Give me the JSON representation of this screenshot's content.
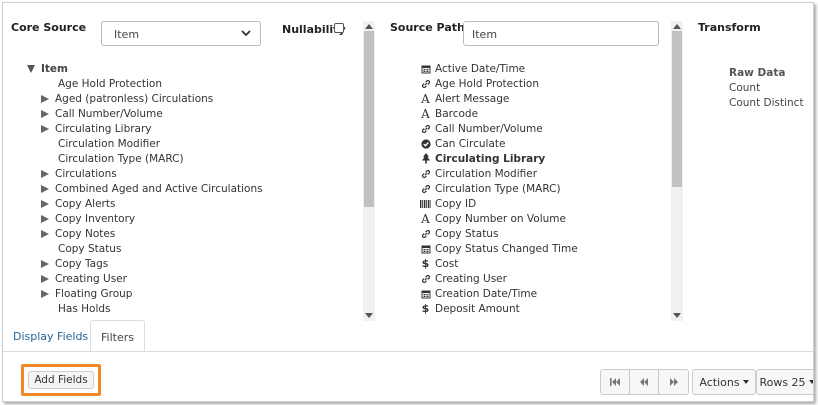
{
  "core_source": {
    "label": "Core Source",
    "selected": "Item",
    "nullability_label": "Nullability"
  },
  "tree": {
    "root": "Item",
    "items": [
      {
        "label": "Age Hold Protection",
        "expandable": false
      },
      {
        "label": "Aged (patronless) Circulations",
        "expandable": true
      },
      {
        "label": "Call Number/Volume",
        "expandable": true
      },
      {
        "label": "Circulating Library",
        "expandable": true
      },
      {
        "label": "Circulation Modifier",
        "expandable": false
      },
      {
        "label": "Circulation Type (MARC)",
        "expandable": false
      },
      {
        "label": "Circulations",
        "expandable": true
      },
      {
        "label": "Combined Aged and Active Circulations",
        "expandable": true
      },
      {
        "label": "Copy Alerts",
        "expandable": true
      },
      {
        "label": "Copy Inventory",
        "expandable": true
      },
      {
        "label": "Copy Notes",
        "expandable": true
      },
      {
        "label": "Copy Status",
        "expandable": false
      },
      {
        "label": "Copy Tags",
        "expandable": true
      },
      {
        "label": "Creating User",
        "expandable": true
      },
      {
        "label": "Floating Group",
        "expandable": true
      },
      {
        "label": "Has Holds",
        "expandable": false
      }
    ]
  },
  "source_path": {
    "label": "Source Path",
    "filter_value": "Item",
    "fields": [
      {
        "label": "Active Date/Time",
        "icon": "calendar-icon",
        "bold": false
      },
      {
        "label": "Age Hold Protection",
        "icon": "link-icon",
        "bold": false
      },
      {
        "label": "Alert Message",
        "icon": "text-icon",
        "bold": false
      },
      {
        "label": "Barcode",
        "icon": "text-icon",
        "bold": false
      },
      {
        "label": "Call Number/Volume",
        "icon": "link-icon",
        "bold": false
      },
      {
        "label": "Can Circulate",
        "icon": "check-circle-icon",
        "bold": false
      },
      {
        "label": "Circulating Library",
        "icon": "org-tree-icon",
        "bold": true
      },
      {
        "label": "Circulation Modifier",
        "icon": "link-icon",
        "bold": false
      },
      {
        "label": "Circulation Type (MARC)",
        "icon": "link-icon",
        "bold": false
      },
      {
        "label": "Copy ID",
        "icon": "barcode-icon",
        "bold": false
      },
      {
        "label": "Copy Number on Volume",
        "icon": "text-icon",
        "bold": false
      },
      {
        "label": "Copy Status",
        "icon": "link-icon",
        "bold": false
      },
      {
        "label": "Copy Status Changed Time",
        "icon": "calendar-icon",
        "bold": false
      },
      {
        "label": "Cost",
        "icon": "dollar-icon",
        "bold": false
      },
      {
        "label": "Creating User",
        "icon": "link-icon",
        "bold": false
      },
      {
        "label": "Creation Date/Time",
        "icon": "calendar-icon",
        "bold": false
      },
      {
        "label": "Deposit Amount",
        "icon": "dollar-icon",
        "bold": false
      }
    ]
  },
  "transform": {
    "label": "Transform",
    "header": "Raw Data",
    "items": [
      "Count",
      "Count Distinct"
    ]
  },
  "tabs": [
    {
      "label": "Display Fields",
      "active": false
    },
    {
      "label": "Filters",
      "active": true
    }
  ],
  "footer": {
    "add_fields": "Add Fields",
    "actions": "Actions",
    "rows": "Rows 25"
  },
  "colors": {
    "highlight": "#f08a24",
    "link": "#2a6496"
  }
}
